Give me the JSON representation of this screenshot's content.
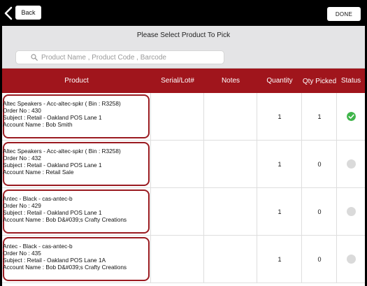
{
  "header": {
    "back_label": "Back",
    "done_label": "DONE"
  },
  "page": {
    "title": "Please Select Product To Pick"
  },
  "search": {
    "placeholder": "Product Name , Product Code , Barcode"
  },
  "table": {
    "columns": {
      "product": "Product",
      "serial": "Serial/Lot#",
      "notes": "Notes",
      "quantity": "Quantity",
      "qty_picked": "Qty Picked",
      "status": "Status"
    },
    "rows": [
      {
        "line1": "Altec Speakers - Acc-altec-spkr ( Bin : R3258)",
        "line2": "Order No : 430",
        "line3": "Subject : Retail - Oakland POS Lane 1",
        "line4": "Account Name : Bob Smith",
        "serial": "",
        "notes": "",
        "quantity": "1",
        "qty_picked": "1",
        "status": "picked"
      },
      {
        "line1": "Altec Speakers - Acc-altec-spkr ( Bin : R3258)",
        "line2": "Order No : 432",
        "line3": "Subject : Retail - Oakland POS Lane 1",
        "line4": "Account Name : Retail Sale",
        "serial": "",
        "notes": "",
        "quantity": "1",
        "qty_picked": "0",
        "status": "pending"
      },
      {
        "line1": "Antec - Black - cas-antec-b",
        "line2": "Order No : 429",
        "line3": "Subject : Retail - Oakland POS Lane 1",
        "line4": "Account Name : Bob D&#039;s Crafty Creations",
        "serial": "",
        "notes": "",
        "quantity": "1",
        "qty_picked": "0",
        "status": "pending"
      },
      {
        "line1": "Antec - Black - cas-antec-b",
        "line2": "Order No : 435",
        "line3": "Subject : Retail - Oakland POS Lane 1A",
        "line4": "Account Name : Bob D&#039;s Crafty Creations",
        "serial": "",
        "notes": "",
        "quantity": "1",
        "qty_picked": "0",
        "status": "pending"
      }
    ]
  },
  "colors": {
    "accent": "#a0151c",
    "status_picked": "#3fb54a",
    "status_pending": "#dadada"
  }
}
